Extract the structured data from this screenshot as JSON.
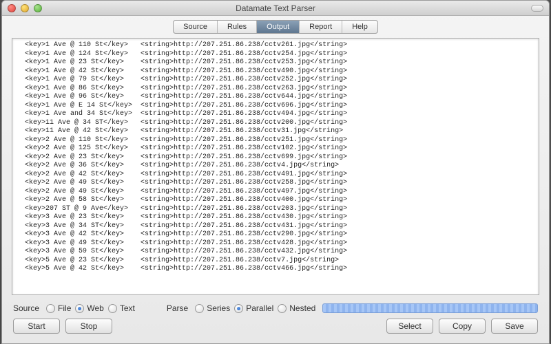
{
  "window": {
    "title": "Datamate Text Parser"
  },
  "tabs": [
    {
      "label": "Source",
      "active": false
    },
    {
      "label": "Rules",
      "active": false
    },
    {
      "label": "Output",
      "active": true
    },
    {
      "label": "Report",
      "active": false
    },
    {
      "label": "Help",
      "active": false
    }
  ],
  "output_rows": [
    {
      "key": "1 Ave @ 110 St",
      "url": "http://207.251.86.238/cctv261.jpg"
    },
    {
      "key": "1 Ave @ 124 St",
      "url": "http://207.251.86.238/cctv254.jpg"
    },
    {
      "key": "1 Ave @ 23 St",
      "url": "http://207.251.86.238/cctv253.jpg"
    },
    {
      "key": "1 Ave @ 42 St",
      "url": "http://207.251.86.238/cctv490.jpg"
    },
    {
      "key": "1 Ave @ 79 St",
      "url": "http://207.251.86.238/cctv252.jpg"
    },
    {
      "key": "1 Ave @ 86 St",
      "url": "http://207.251.86.238/cctv263.jpg"
    },
    {
      "key": "1 Ave @ 96 St",
      "url": "http://207.251.86.238/cctv644.jpg"
    },
    {
      "key": "1 Ave @ E 14 St",
      "url": "http://207.251.86.238/cctv696.jpg"
    },
    {
      "key": "1 Ave and 34 St",
      "url": "http://207.251.86.238/cctv494.jpg"
    },
    {
      "key": "11 Ave @ 34 ST",
      "url": "http://207.251.86.238/cctv200.jpg"
    },
    {
      "key": "11 Ave @ 42 St",
      "url": "http://207.251.86.238/cctv31.jpg"
    },
    {
      "key": "2 Ave @ 110 St",
      "url": "http://207.251.86.238/cctv251.jpg"
    },
    {
      "key": "2 Ave @ 125 St",
      "url": "http://207.251.86.238/cctv102.jpg"
    },
    {
      "key": "2 Ave @ 23 St",
      "url": "http://207.251.86.238/cctv699.jpg"
    },
    {
      "key": "2 Ave @ 36 St",
      "url": "http://207.251.86.238/cctv4.jpg"
    },
    {
      "key": "2 Ave @ 42 St",
      "url": "http://207.251.86.238/cctv491.jpg"
    },
    {
      "key": "2 Ave @ 49 St",
      "url": "http://207.251.86.238/cctv258.jpg"
    },
    {
      "key": "2 Ave @ 49 St",
      "url": "http://207.251.86.238/cctv497.jpg"
    },
    {
      "key": "2 Ave @ 58 St",
      "url": "http://207.251.86.238/cctv400.jpg"
    },
    {
      "key": "207 ST @ 9 Ave",
      "url": "http://207.251.86.238/cctv203.jpg"
    },
    {
      "key": "3 Ave @ 23 St",
      "url": "http://207.251.86.238/cctv430.jpg"
    },
    {
      "key": "3 Ave @ 34 ST",
      "url": "http://207.251.86.238/cctv431.jpg"
    },
    {
      "key": "3 Ave @ 42 St",
      "url": "http://207.251.86.238/cctv290.jpg"
    },
    {
      "key": "3 Ave @ 49 St",
      "url": "http://207.251.86.238/cctv428.jpg"
    },
    {
      "key": "3 Ave @ 59 St",
      "url": "http://207.251.86.238/cctv432.jpg"
    },
    {
      "key": "5 Ave @ 23 St",
      "url": "http://207.251.86.238/cctv7.jpg"
    },
    {
      "key": "5 Ave @ 42 St",
      "url": "http://207.251.86.238/cctv466.jpg"
    }
  ],
  "source": {
    "label": "Source",
    "options": [
      {
        "label": "File",
        "selected": false
      },
      {
        "label": "Web",
        "selected": true
      },
      {
        "label": "Text",
        "selected": false
      }
    ]
  },
  "parse": {
    "label": "Parse",
    "options": [
      {
        "label": "Series",
        "selected": false
      },
      {
        "label": "Parallel",
        "selected": true
      },
      {
        "label": "Nested",
        "selected": false
      }
    ]
  },
  "buttons": {
    "start": "Start",
    "stop": "Stop",
    "select": "Select",
    "copy": "Copy",
    "save": "Save"
  }
}
